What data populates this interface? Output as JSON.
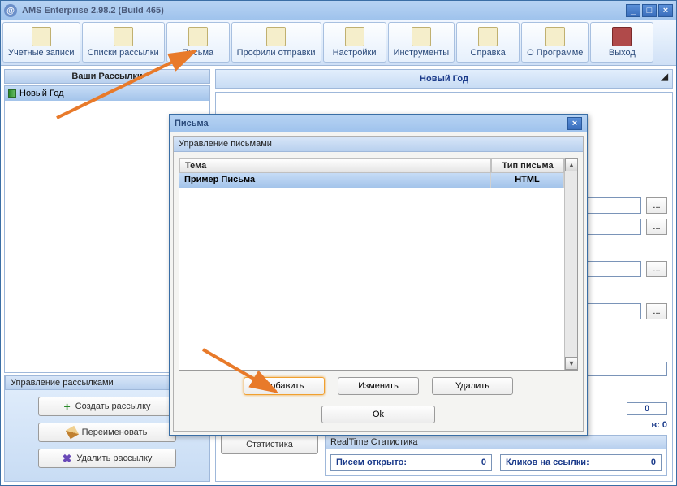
{
  "window": {
    "title": "AMS Enterprise 2.98.2 (Build 465)"
  },
  "toolbar": {
    "accounts": "Учетные записи",
    "lists": "Списки рассылки",
    "letters": "Письма",
    "profiles": "Профили отправки",
    "settings": "Настройки",
    "tools": "Инструменты",
    "help": "Справка",
    "about": "О Программе",
    "exit": "Выход"
  },
  "left": {
    "header": "Ваши Рассылки",
    "item1": "Новый Год",
    "manage_header": "Управление рассылками",
    "create": "Создать рассылку",
    "rename": "Переименовать",
    "delete": "Удалить рассылку"
  },
  "right": {
    "title": "Новый Год",
    "stat_btn": "Статистика",
    "rt_header": "RealTime Статистика",
    "opened_label": "Писем открыто:",
    "opened_val": "0",
    "clicks_label": "Кликов на ссылки:",
    "clicks_val": "0",
    "zero": "0",
    "row_suffix": "в:   0"
  },
  "dialog": {
    "title": "Письма",
    "group": "Управление письмами",
    "col_subject": "Тема",
    "col_type": "Тип письма",
    "row_subject": "Пример Письма",
    "row_type": "HTML",
    "add": "Добавить",
    "edit": "Изменить",
    "del": "Удалить",
    "ok": "Ok"
  }
}
